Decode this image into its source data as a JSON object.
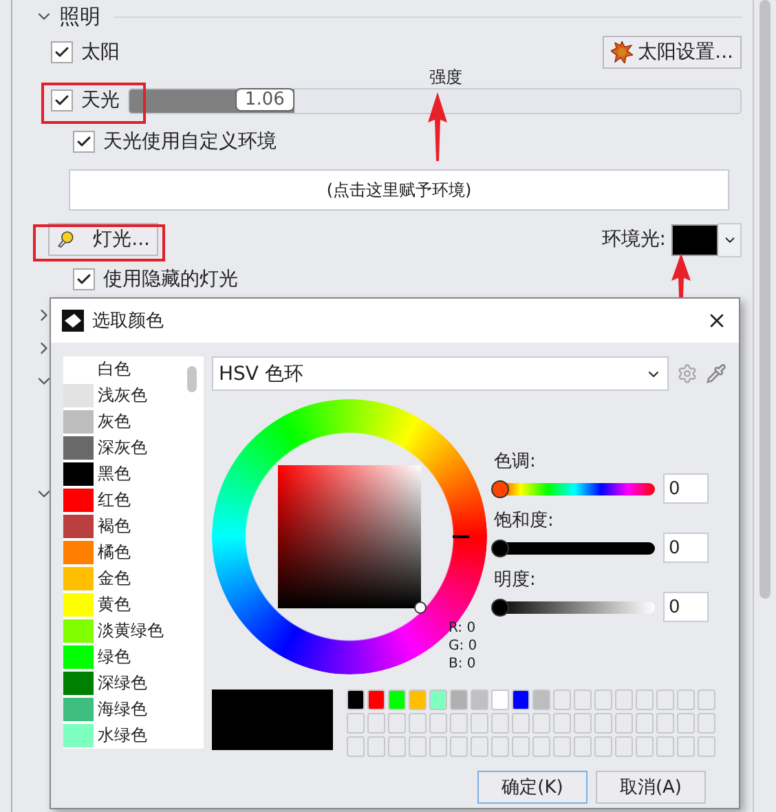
{
  "section": {
    "title": "照明",
    "expanded": true
  },
  "sun": {
    "label": "太阳",
    "checked": true,
    "button": "太阳设置..."
  },
  "skylight": {
    "label": "天光",
    "checked": true,
    "caption": "强度",
    "level": 0.27,
    "value": "1.06"
  },
  "custom_env": {
    "label": "天光使用自定义环境",
    "checked": true
  },
  "env_button": "(点击这里赋予环境)",
  "lights_button": "灯光...",
  "ambient": {
    "label": "环境光:",
    "color": "#000000"
  },
  "hidden_lights": {
    "label": "使用隐藏的灯光",
    "checked": true
  },
  "other_sections": [
    {
      "expanded": false
    },
    {
      "expanded": false
    },
    {
      "expanded": true
    },
    {
      "expanded": true
    }
  ],
  "dialog": {
    "title": "选取颜色",
    "colors": [
      {
        "name": "白色",
        "color": "#ffffff"
      },
      {
        "name": "浅灰色",
        "color": "#e3e3e3"
      },
      {
        "name": "灰色",
        "color": "#bdbdbd"
      },
      {
        "name": "深灰色",
        "color": "#696969"
      },
      {
        "name": "黑色",
        "color": "#000000"
      },
      {
        "name": "红色",
        "color": "#ff0000"
      },
      {
        "name": "褐色",
        "color": "#bc3f3f"
      },
      {
        "name": "橘色",
        "color": "#ff7f00"
      },
      {
        "name": "金色",
        "color": "#ffbf00"
      },
      {
        "name": "黄色",
        "color": "#ffff00"
      },
      {
        "name": "淡黄绿色",
        "color": "#7fff00"
      },
      {
        "name": "绿色",
        "color": "#00ff00"
      },
      {
        "name": "深绿色",
        "color": "#007f00"
      },
      {
        "name": "海绿色",
        "color": "#3fbf7f"
      },
      {
        "name": "水绿色",
        "color": "#7fffbf"
      }
    ],
    "mode": "HSV 色环",
    "sliders": [
      {
        "kind": "hue",
        "label": "色调:",
        "value": "0",
        "level": 0
      },
      {
        "kind": "saturation",
        "label": "饱和度:",
        "value": "0",
        "level": 0
      },
      {
        "kind": "brightness",
        "label": "明度:",
        "value": "0",
        "level": 0
      }
    ],
    "rgb": [
      "R: 0",
      "G: 0",
      "B: 0"
    ],
    "preview": {
      "color": "#000000"
    },
    "custom_colors": [
      {
        "color": "#000000"
      },
      {
        "color": "#ff0000"
      },
      {
        "color": "#00ff00"
      },
      {
        "color": "#ffbf00"
      },
      {
        "color": "#7fffbf"
      },
      {
        "color": "#b0b0b0"
      },
      {
        "color": "#c0c0c0"
      },
      {
        "color": "#ffffff"
      },
      {
        "color": "#0000ff"
      },
      {
        "color": "#bdbdbd"
      }
    ],
    "buttons": [
      {
        "label": "确定(K)",
        "default": true
      },
      {
        "label": "取消(A)",
        "default": false
      }
    ]
  }
}
